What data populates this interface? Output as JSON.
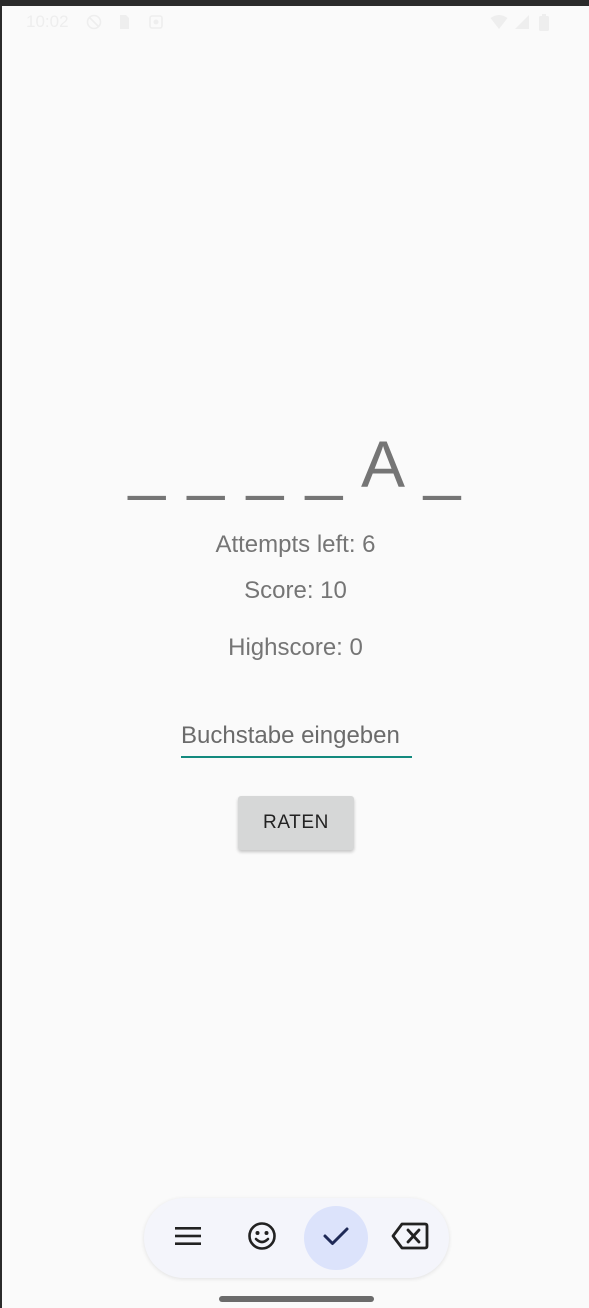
{
  "status_bar": {
    "time": "10:02",
    "left_icons": [
      "no-disturb-icon",
      "sim-card-icon",
      "notification-icon"
    ],
    "right_icons": [
      "wifi-icon",
      "signal-icon",
      "battery-icon"
    ]
  },
  "game": {
    "word_display": "_ _ _ _ A _",
    "attempts_left": "Attempts left: 6",
    "score": "Score: 10",
    "highscore": "Highscore: 0"
  },
  "guess_input": {
    "placeholder": "Buchstabe eingeben",
    "value": ""
  },
  "guess_button": {
    "label": "RATEN"
  },
  "keyboard_toolbar": {
    "items": [
      {
        "icon": "menu-icon",
        "active": false
      },
      {
        "icon": "emoji-icon",
        "active": false
      },
      {
        "icon": "checkmark-icon",
        "active": true
      },
      {
        "icon": "backspace-icon",
        "active": false
      }
    ]
  },
  "colors": {
    "background": "#fafafa",
    "text": "#757575",
    "accent": "#138a7e",
    "button": "#d6d7d7",
    "toolbar_active": "#dce3fb"
  }
}
